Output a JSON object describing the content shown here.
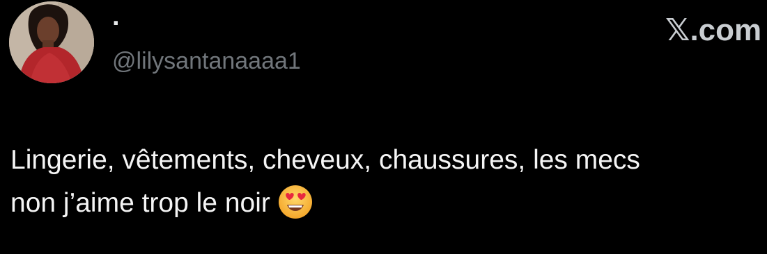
{
  "tweet": {
    "author": {
      "display_name": "·",
      "handle": "@lilysantanaaaa1",
      "avatar_icon": "profile-photo"
    },
    "brand": "𝕏.com",
    "text_lines": [
      "Lingerie, vêtements, cheveux, chaussures, les mecs",
      "non j’aime trop le noir"
    ],
    "emoji": "smiling-face-with-heart-eyes"
  },
  "colors": {
    "background": "#000000",
    "text": "#f5f5f5",
    "secondary": "#71767b",
    "brand": "#c9cdd1"
  }
}
